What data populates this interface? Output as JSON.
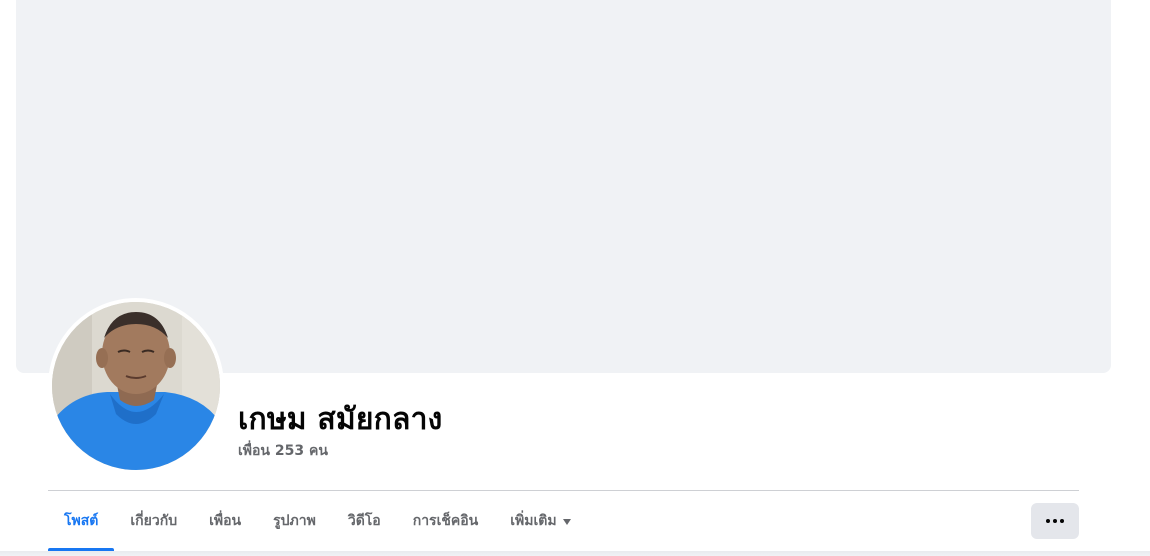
{
  "profile": {
    "name": "เกษม สมัยกลาง",
    "friends": "เพื่อน 253 คน",
    "avatar": "profile-photo-man-blue-shirt"
  },
  "tabs": [
    {
      "label": "โพสต์",
      "active": true
    },
    {
      "label": "เกี่ยวกับ",
      "active": false
    },
    {
      "label": "เพื่อน",
      "active": false
    },
    {
      "label": "รูปภาพ",
      "active": false
    },
    {
      "label": "วิดีโอ",
      "active": false
    },
    {
      "label": "การเช็คอิน",
      "active": false
    },
    {
      "label": "เพิ่มเติม",
      "active": false,
      "icon": "caret-down-icon"
    }
  ],
  "actions": {
    "more_icon": "ellipsis-icon"
  },
  "colors": {
    "accent": "#1877f2",
    "cover_background": "#f0f2f5",
    "secondary_text": "#65676b",
    "button_background": "#e4e6eb"
  }
}
